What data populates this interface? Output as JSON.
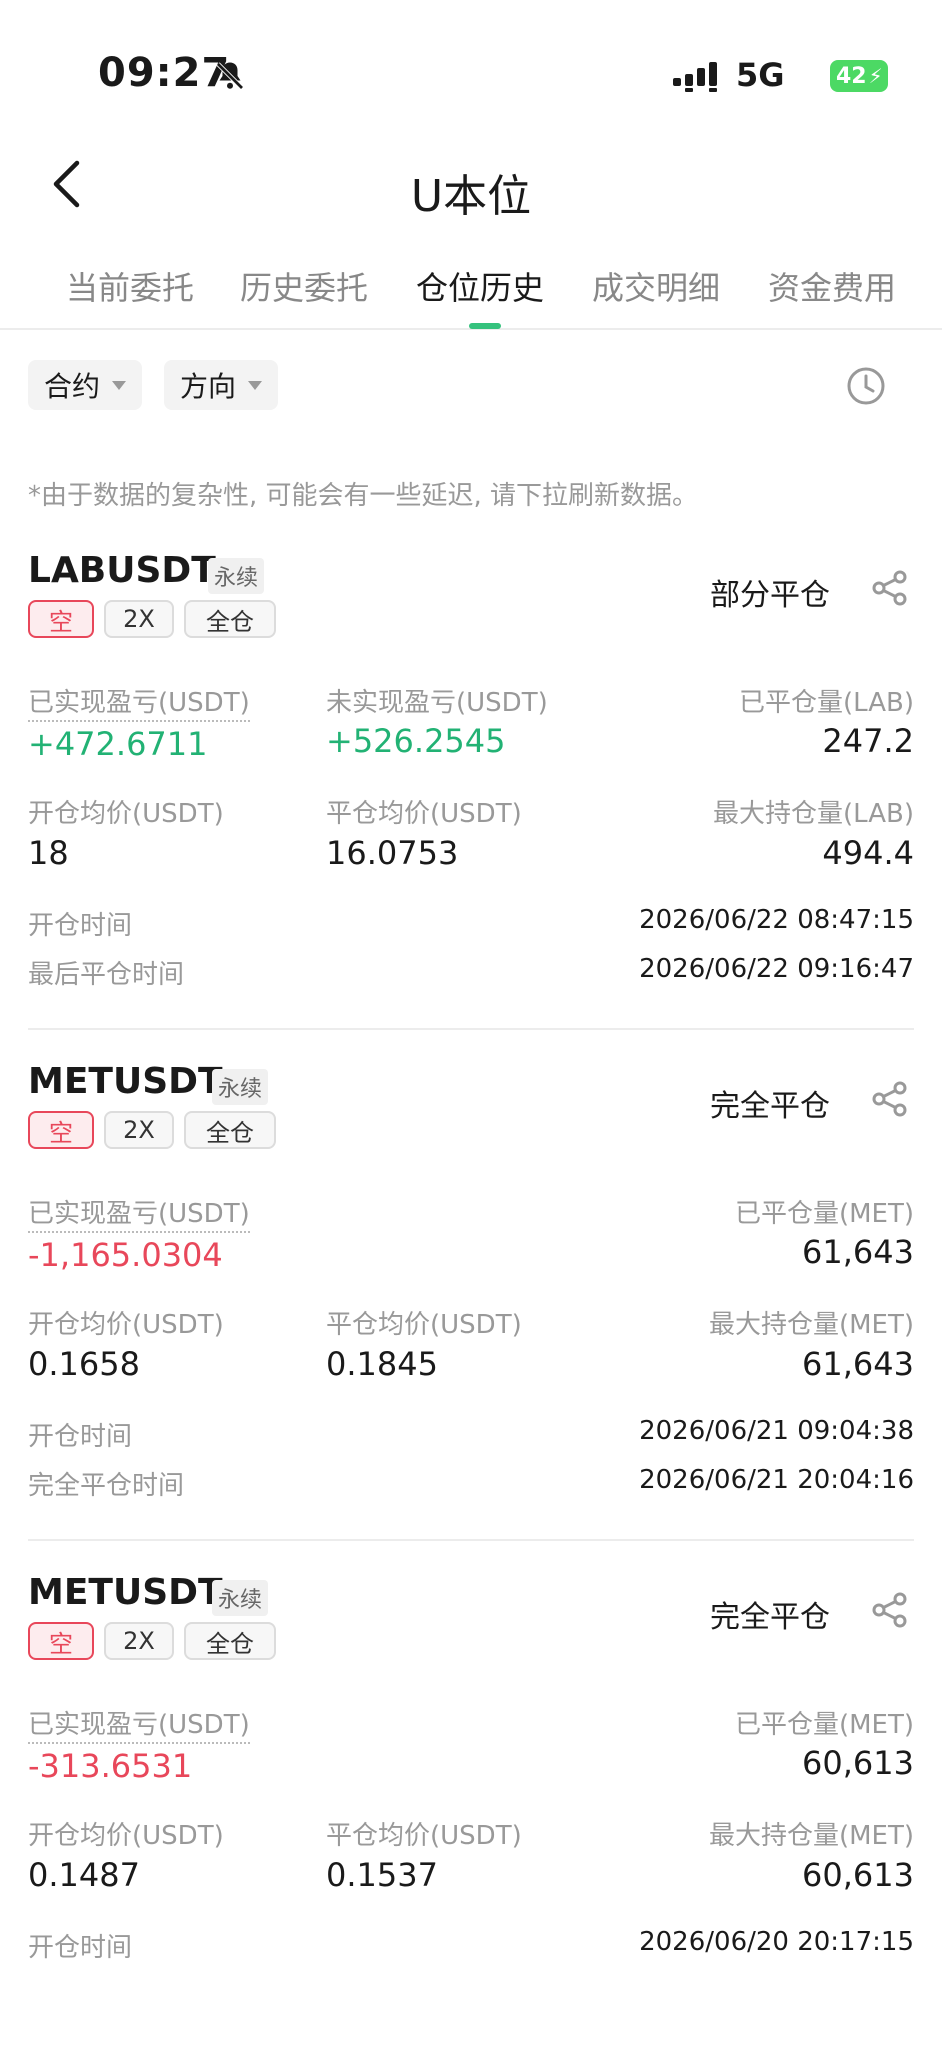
{
  "status_bar": {
    "time": "09:27",
    "network": "5G",
    "battery": "42"
  },
  "header": {
    "title": "U本位"
  },
  "tabs": [
    "当前委托",
    "历史委托",
    "仓位历史",
    "成交明细",
    "资金费用"
  ],
  "filters": {
    "contract": "合约",
    "direction": "方向"
  },
  "notice": "*由于数据的复杂性, 可能会有一些延迟, 请下拉刷新数据。",
  "cards": [
    {
      "symbol": "LABUSDT",
      "perp": "永续",
      "side": "空",
      "leverage": "2X",
      "margin_mode": "全仓",
      "status": "部分平仓",
      "realized_label": "已实现盈亏(USDT)",
      "realized_value": "+472.6711",
      "unrealized_label": "未实现盈亏(USDT)",
      "unrealized_value": "+526.2545",
      "closed_qty_label": "已平仓量(LAB)",
      "closed_qty_value": "247.2",
      "open_price_label": "开仓均价(USDT)",
      "open_price_value": "18",
      "close_price_label": "平仓均价(USDT)",
      "close_price_value": "16.0753",
      "max_pos_label": "最大持仓量(LAB)",
      "max_pos_value": "494.4",
      "open_time_label": "开仓时间",
      "open_time_value": "2026/06/22 08:47:15",
      "close_time_label": "最后平仓时间",
      "close_time_value": "2026/06/22 09:16:47"
    },
    {
      "symbol": "METUSDT",
      "perp": "永续",
      "side": "空",
      "leverage": "2X",
      "margin_mode": "全仓",
      "status": "完全平仓",
      "realized_label": "已实现盈亏(USDT)",
      "realized_value": "-1,165.0304",
      "closed_qty_label": "已平仓量(MET)",
      "closed_qty_value": "61,643",
      "open_price_label": "开仓均价(USDT)",
      "open_price_value": "0.1658",
      "close_price_label": "平仓均价(USDT)",
      "close_price_value": "0.1845",
      "max_pos_label": "最大持仓量(MET)",
      "max_pos_value": "61,643",
      "open_time_label": "开仓时间",
      "open_time_value": "2026/06/21 09:04:38",
      "close_time_label": "完全平仓时间",
      "close_time_value": "2026/06/21 20:04:16"
    },
    {
      "symbol": "METUSDT",
      "perp": "永续",
      "side": "空",
      "leverage": "2X",
      "margin_mode": "全仓",
      "status": "完全平仓",
      "realized_label": "已实现盈亏(USDT)",
      "realized_value": "-313.6531",
      "closed_qty_label": "已平仓量(MET)",
      "closed_qty_value": "60,613",
      "open_price_label": "开仓均价(USDT)",
      "open_price_value": "0.1487",
      "close_price_label": "平仓均价(USDT)",
      "close_price_value": "0.1537",
      "max_pos_label": "最大持仓量(MET)",
      "max_pos_value": "60,613",
      "open_time_label": "开仓时间",
      "open_time_value": "2026/06/20 20:17:15"
    }
  ],
  "colors": {
    "accent": "#35c27d",
    "profit": "#22b274",
    "loss": "#e8475a"
  }
}
